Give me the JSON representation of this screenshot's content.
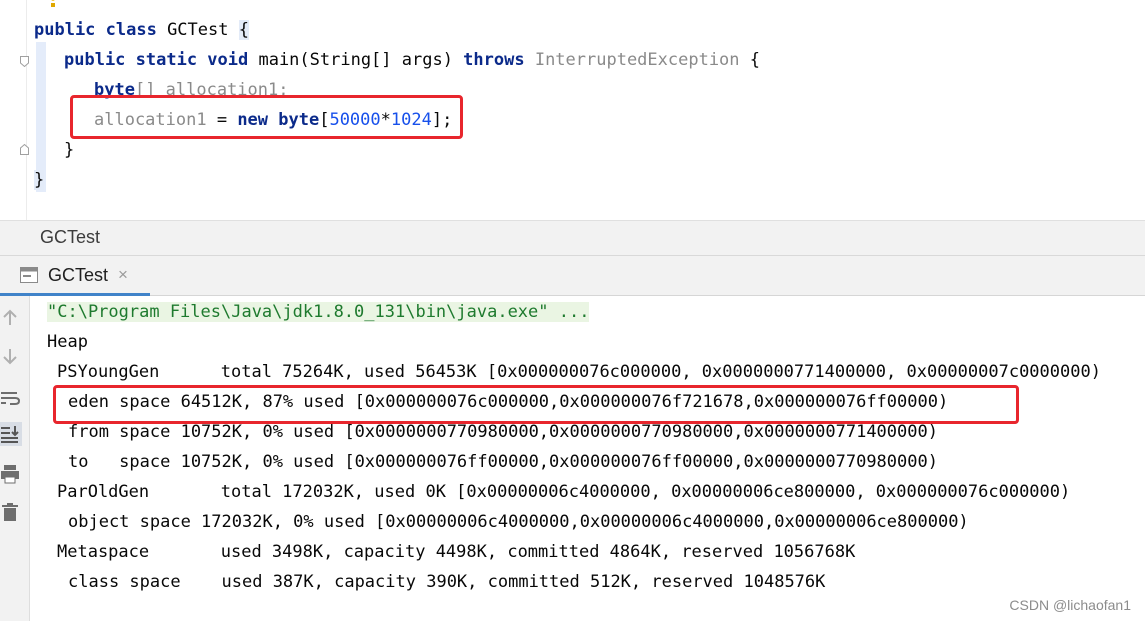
{
  "editor": {
    "lines": {
      "l1": {
        "kw1": "public class ",
        "name": "GCTest ",
        "brace": "{"
      },
      "l2": {
        "kw1": "public static void ",
        "name": "main(String[] args) ",
        "kw2": "throws ",
        "exc": "InterruptedException",
        "tail": " {"
      },
      "l3": {
        "kw1": "byte",
        "rest": "[] allocation1;"
      },
      "l4": {
        "var": "allocation1",
        "eq": " = ",
        "kw1": "new byte",
        "lb": "[",
        "n1": "50000",
        "op": "*",
        "n2": "1024",
        "rb": "];"
      },
      "l5": {
        "text": "}"
      },
      "l6": {
        "text": "}"
      }
    }
  },
  "run_bar": {
    "title": "GCTest"
  },
  "tab": {
    "label": "GCTest",
    "close": "×"
  },
  "console": {
    "command": "\"C:\\Program Files\\Java\\jdk1.8.0_131\\bin\\java.exe\" ...",
    "heap": "Heap",
    "psyoung": "PSYoungGen      total 75264K, used 56453K [0x000000076c000000, 0x0000000771400000, 0x00000007c0000000)",
    "eden": "eden space 64512K, 87% used [0x000000076c000000,0x000000076f721678,0x000000076ff00000)",
    "from": "from space 10752K, 0% used [0x0000000770980000,0x0000000770980000,0x0000000771400000)",
    "to": "to   space 10752K, 0% used [0x000000076ff00000,0x000000076ff00000,0x0000000770980000)",
    "parold": "ParOldGen       total 172032K, used 0K [0x00000006c4000000, 0x00000006ce800000, 0x000000076c000000)",
    "object": "object space 172032K, 0% used [0x00000006c4000000,0x00000006c4000000,0x00000006ce800000)",
    "metaspace": "Metaspace       used 3498K, capacity 4498K, committed 4864K, reserved 1056768K",
    "classspace": "class space    used 387K, capacity 390K, committed 512K, reserved 1048576K"
  },
  "watermark": "CSDN @lichaofan1",
  "colors": {
    "highlight_box": "#e8262d",
    "keyword": "#0b2a8a",
    "number": "#1750eb",
    "command": "#1e7a2e"
  }
}
